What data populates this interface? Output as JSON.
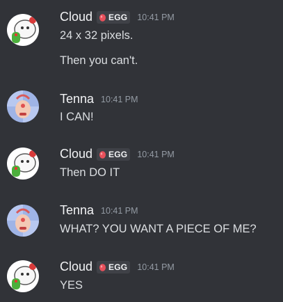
{
  "messages": [
    {
      "author": "Cloud",
      "tag": "EGG",
      "time": "10:41 PM",
      "lines": [
        "24 x 32 pixels.",
        "Then you can't."
      ]
    },
    {
      "author": "Tenna",
      "time": "10:41 PM",
      "lines": [
        "I CAN!"
      ]
    },
    {
      "author": "Cloud",
      "tag": "EGG",
      "time": "10:41 PM",
      "lines": [
        "Then DO IT"
      ]
    },
    {
      "author": "Tenna",
      "time": "10:41 PM",
      "lines": [
        "WHAT? YOU WANT A PIECE OF ME?"
      ]
    },
    {
      "author": "Cloud",
      "tag": "EGG",
      "time": "10:41 PM",
      "lines": [
        "YES"
      ]
    }
  ],
  "icons": {
    "cloud_avatar": "cloud-avatar-icon",
    "tenna_avatar": "tenna-avatar-icon",
    "egg_tag": "egg-icon"
  },
  "colors": {
    "background": "#313338",
    "username": "#f2f3f5",
    "message_text": "#dbdee1",
    "timestamp": "#949ba4",
    "tag_background": "#3f4147",
    "egg_icon": "#e8505b"
  }
}
